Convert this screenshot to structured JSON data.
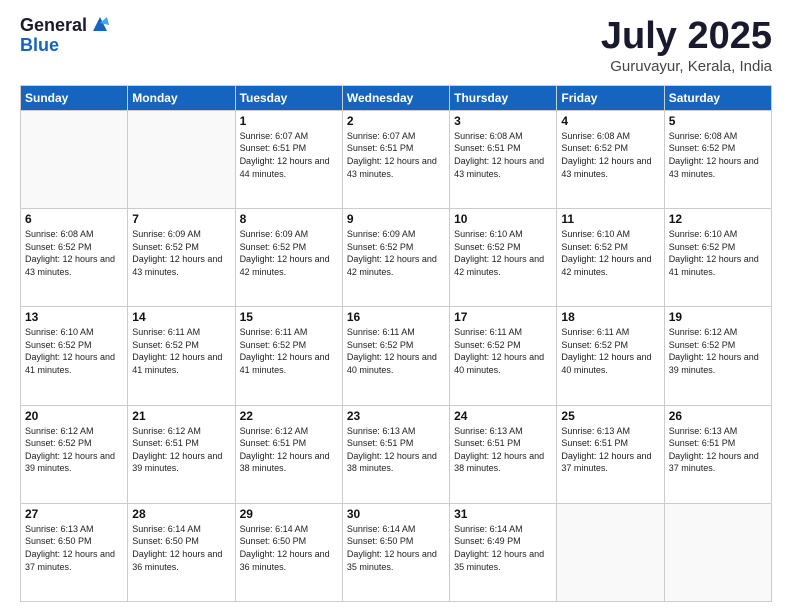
{
  "header": {
    "logo_general": "General",
    "logo_blue": "Blue",
    "month": "July 2025",
    "location": "Guruvayur, Kerala, India"
  },
  "weekdays": [
    "Sunday",
    "Monday",
    "Tuesday",
    "Wednesday",
    "Thursday",
    "Friday",
    "Saturday"
  ],
  "weeks": [
    [
      {
        "day": null,
        "sunrise": null,
        "sunset": null,
        "daylight": null
      },
      {
        "day": null,
        "sunrise": null,
        "sunset": null,
        "daylight": null
      },
      {
        "day": "1",
        "sunrise": "Sunrise: 6:07 AM",
        "sunset": "Sunset: 6:51 PM",
        "daylight": "Daylight: 12 hours and 44 minutes."
      },
      {
        "day": "2",
        "sunrise": "Sunrise: 6:07 AM",
        "sunset": "Sunset: 6:51 PM",
        "daylight": "Daylight: 12 hours and 43 minutes."
      },
      {
        "day": "3",
        "sunrise": "Sunrise: 6:08 AM",
        "sunset": "Sunset: 6:51 PM",
        "daylight": "Daylight: 12 hours and 43 minutes."
      },
      {
        "day": "4",
        "sunrise": "Sunrise: 6:08 AM",
        "sunset": "Sunset: 6:52 PM",
        "daylight": "Daylight: 12 hours and 43 minutes."
      },
      {
        "day": "5",
        "sunrise": "Sunrise: 6:08 AM",
        "sunset": "Sunset: 6:52 PM",
        "daylight": "Daylight: 12 hours and 43 minutes."
      }
    ],
    [
      {
        "day": "6",
        "sunrise": "Sunrise: 6:08 AM",
        "sunset": "Sunset: 6:52 PM",
        "daylight": "Daylight: 12 hours and 43 minutes."
      },
      {
        "day": "7",
        "sunrise": "Sunrise: 6:09 AM",
        "sunset": "Sunset: 6:52 PM",
        "daylight": "Daylight: 12 hours and 43 minutes."
      },
      {
        "day": "8",
        "sunrise": "Sunrise: 6:09 AM",
        "sunset": "Sunset: 6:52 PM",
        "daylight": "Daylight: 12 hours and 42 minutes."
      },
      {
        "day": "9",
        "sunrise": "Sunrise: 6:09 AM",
        "sunset": "Sunset: 6:52 PM",
        "daylight": "Daylight: 12 hours and 42 minutes."
      },
      {
        "day": "10",
        "sunrise": "Sunrise: 6:10 AM",
        "sunset": "Sunset: 6:52 PM",
        "daylight": "Daylight: 12 hours and 42 minutes."
      },
      {
        "day": "11",
        "sunrise": "Sunrise: 6:10 AM",
        "sunset": "Sunset: 6:52 PM",
        "daylight": "Daylight: 12 hours and 42 minutes."
      },
      {
        "day": "12",
        "sunrise": "Sunrise: 6:10 AM",
        "sunset": "Sunset: 6:52 PM",
        "daylight": "Daylight: 12 hours and 41 minutes."
      }
    ],
    [
      {
        "day": "13",
        "sunrise": "Sunrise: 6:10 AM",
        "sunset": "Sunset: 6:52 PM",
        "daylight": "Daylight: 12 hours and 41 minutes."
      },
      {
        "day": "14",
        "sunrise": "Sunrise: 6:11 AM",
        "sunset": "Sunset: 6:52 PM",
        "daylight": "Daylight: 12 hours and 41 minutes."
      },
      {
        "day": "15",
        "sunrise": "Sunrise: 6:11 AM",
        "sunset": "Sunset: 6:52 PM",
        "daylight": "Daylight: 12 hours and 41 minutes."
      },
      {
        "day": "16",
        "sunrise": "Sunrise: 6:11 AM",
        "sunset": "Sunset: 6:52 PM",
        "daylight": "Daylight: 12 hours and 40 minutes."
      },
      {
        "day": "17",
        "sunrise": "Sunrise: 6:11 AM",
        "sunset": "Sunset: 6:52 PM",
        "daylight": "Daylight: 12 hours and 40 minutes."
      },
      {
        "day": "18",
        "sunrise": "Sunrise: 6:11 AM",
        "sunset": "Sunset: 6:52 PM",
        "daylight": "Daylight: 12 hours and 40 minutes."
      },
      {
        "day": "19",
        "sunrise": "Sunrise: 6:12 AM",
        "sunset": "Sunset: 6:52 PM",
        "daylight": "Daylight: 12 hours and 39 minutes."
      }
    ],
    [
      {
        "day": "20",
        "sunrise": "Sunrise: 6:12 AM",
        "sunset": "Sunset: 6:52 PM",
        "daylight": "Daylight: 12 hours and 39 minutes."
      },
      {
        "day": "21",
        "sunrise": "Sunrise: 6:12 AM",
        "sunset": "Sunset: 6:51 PM",
        "daylight": "Daylight: 12 hours and 39 minutes."
      },
      {
        "day": "22",
        "sunrise": "Sunrise: 6:12 AM",
        "sunset": "Sunset: 6:51 PM",
        "daylight": "Daylight: 12 hours and 38 minutes."
      },
      {
        "day": "23",
        "sunrise": "Sunrise: 6:13 AM",
        "sunset": "Sunset: 6:51 PM",
        "daylight": "Daylight: 12 hours and 38 minutes."
      },
      {
        "day": "24",
        "sunrise": "Sunrise: 6:13 AM",
        "sunset": "Sunset: 6:51 PM",
        "daylight": "Daylight: 12 hours and 38 minutes."
      },
      {
        "day": "25",
        "sunrise": "Sunrise: 6:13 AM",
        "sunset": "Sunset: 6:51 PM",
        "daylight": "Daylight: 12 hours and 37 minutes."
      },
      {
        "day": "26",
        "sunrise": "Sunrise: 6:13 AM",
        "sunset": "Sunset: 6:51 PM",
        "daylight": "Daylight: 12 hours and 37 minutes."
      }
    ],
    [
      {
        "day": "27",
        "sunrise": "Sunrise: 6:13 AM",
        "sunset": "Sunset: 6:50 PM",
        "daylight": "Daylight: 12 hours and 37 minutes."
      },
      {
        "day": "28",
        "sunrise": "Sunrise: 6:14 AM",
        "sunset": "Sunset: 6:50 PM",
        "daylight": "Daylight: 12 hours and 36 minutes."
      },
      {
        "day": "29",
        "sunrise": "Sunrise: 6:14 AM",
        "sunset": "Sunset: 6:50 PM",
        "daylight": "Daylight: 12 hours and 36 minutes."
      },
      {
        "day": "30",
        "sunrise": "Sunrise: 6:14 AM",
        "sunset": "Sunset: 6:50 PM",
        "daylight": "Daylight: 12 hours and 35 minutes."
      },
      {
        "day": "31",
        "sunrise": "Sunrise: 6:14 AM",
        "sunset": "Sunset: 6:49 PM",
        "daylight": "Daylight: 12 hours and 35 minutes."
      },
      {
        "day": null,
        "sunrise": null,
        "sunset": null,
        "daylight": null
      },
      {
        "day": null,
        "sunrise": null,
        "sunset": null,
        "daylight": null
      }
    ]
  ]
}
